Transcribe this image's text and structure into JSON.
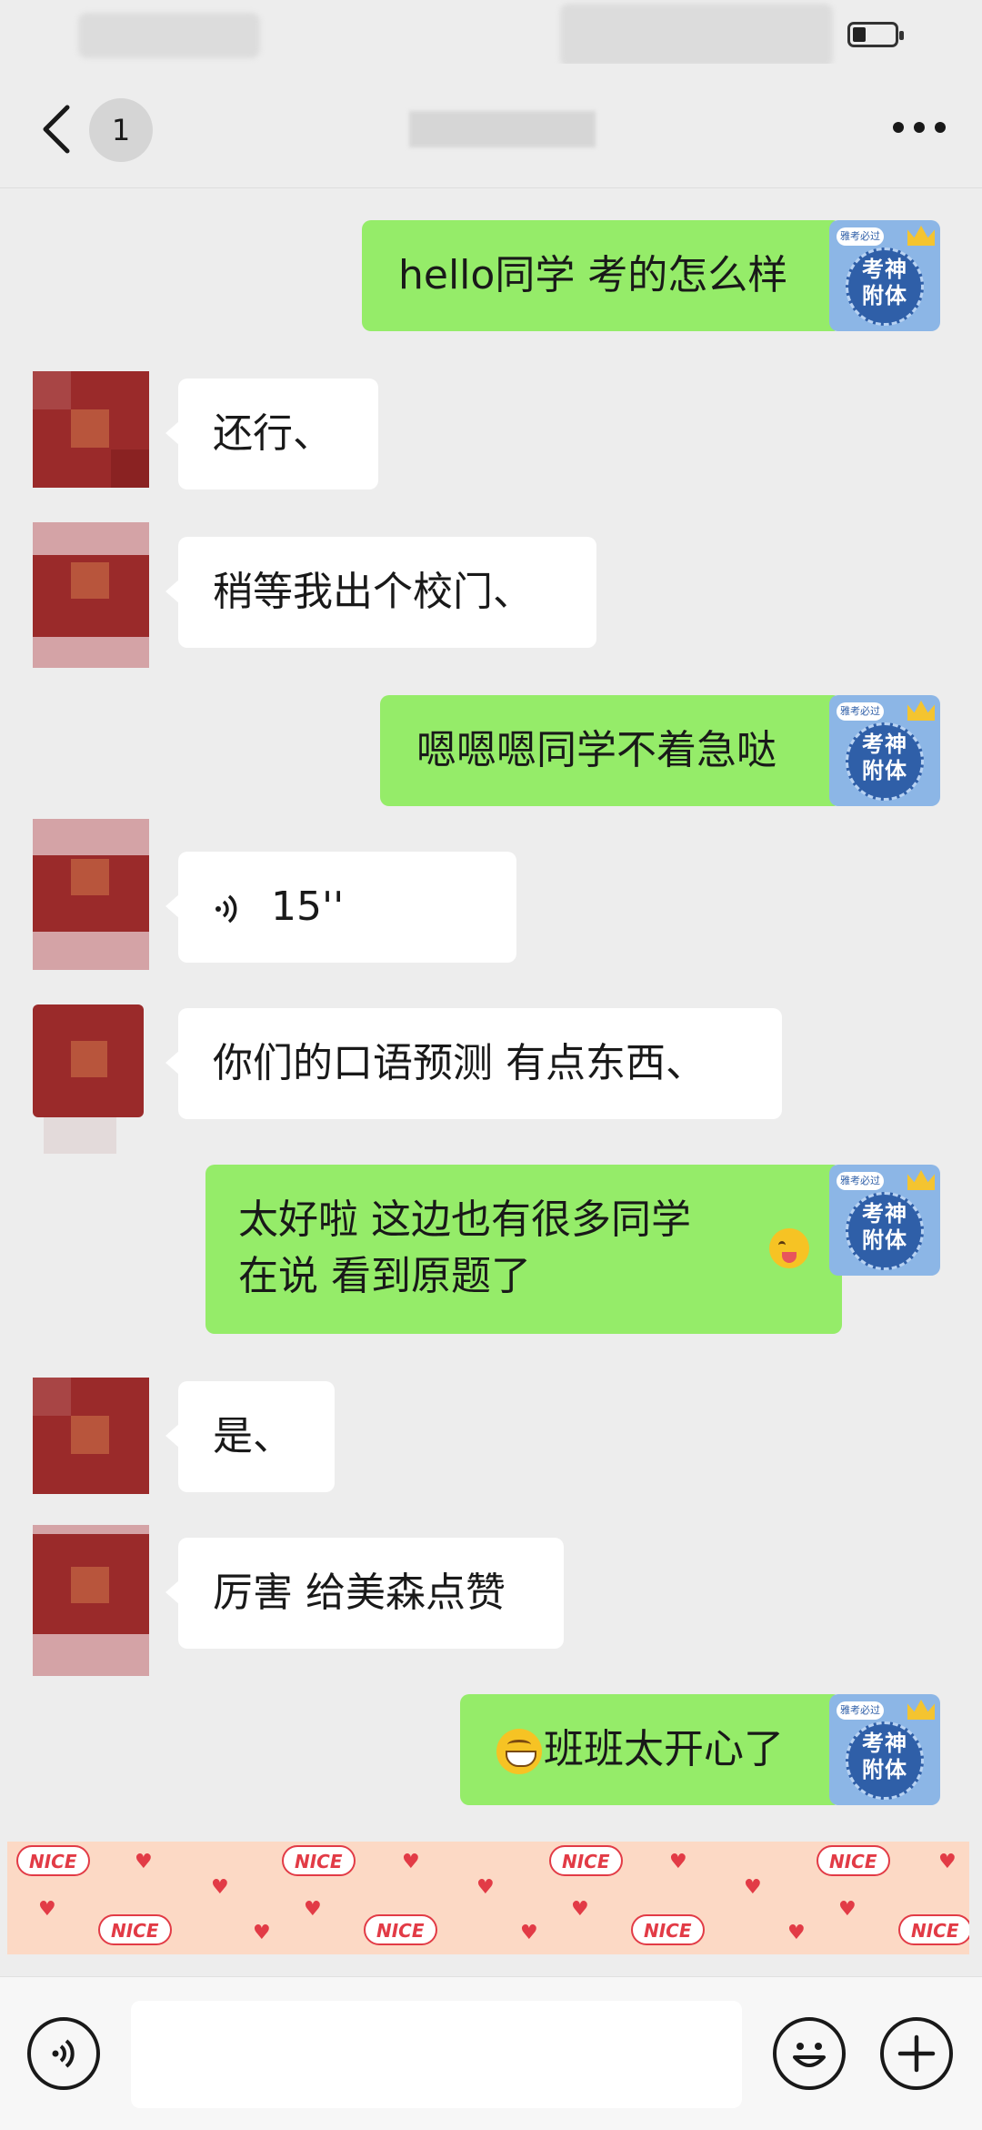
{
  "header": {
    "unread_count": "1"
  },
  "messages": [
    {
      "from": "me",
      "text": "hello同学 考的怎么样"
    },
    {
      "from": "them",
      "text": "还行、"
    },
    {
      "from": "them",
      "text": "稍等我出个校门、"
    },
    {
      "from": "me",
      "text": "嗯嗯嗯同学不着急哒"
    },
    {
      "from": "them",
      "type": "voice",
      "text": "15''"
    },
    {
      "from": "them",
      "text": "你们的口语预测 有点东西、"
    },
    {
      "from": "me",
      "text_line1": "太好啦 这边也有很多同学",
      "text_line2": "在说 看到原题了",
      "emoji": "wink-tongue-emoji"
    },
    {
      "from": "them",
      "text": "是、"
    },
    {
      "from": "them",
      "text": "厉害 给美森点赞"
    },
    {
      "from": "me",
      "text": "班班太开心了",
      "emoji": "grin-emoji"
    }
  ],
  "my_avatar": {
    "line1": "考神",
    "line2": "附体",
    "tag": "雅考必过"
  },
  "sticker": {
    "label": "NICE"
  },
  "colors": {
    "my_bubble": "#95ec69",
    "their_bubble": "#ffffff",
    "background": "#ededed"
  },
  "icons": [
    "back-icon",
    "more-icon",
    "voice-icon",
    "voice-toggle-icon",
    "emoji-icon",
    "plus-icon"
  ]
}
